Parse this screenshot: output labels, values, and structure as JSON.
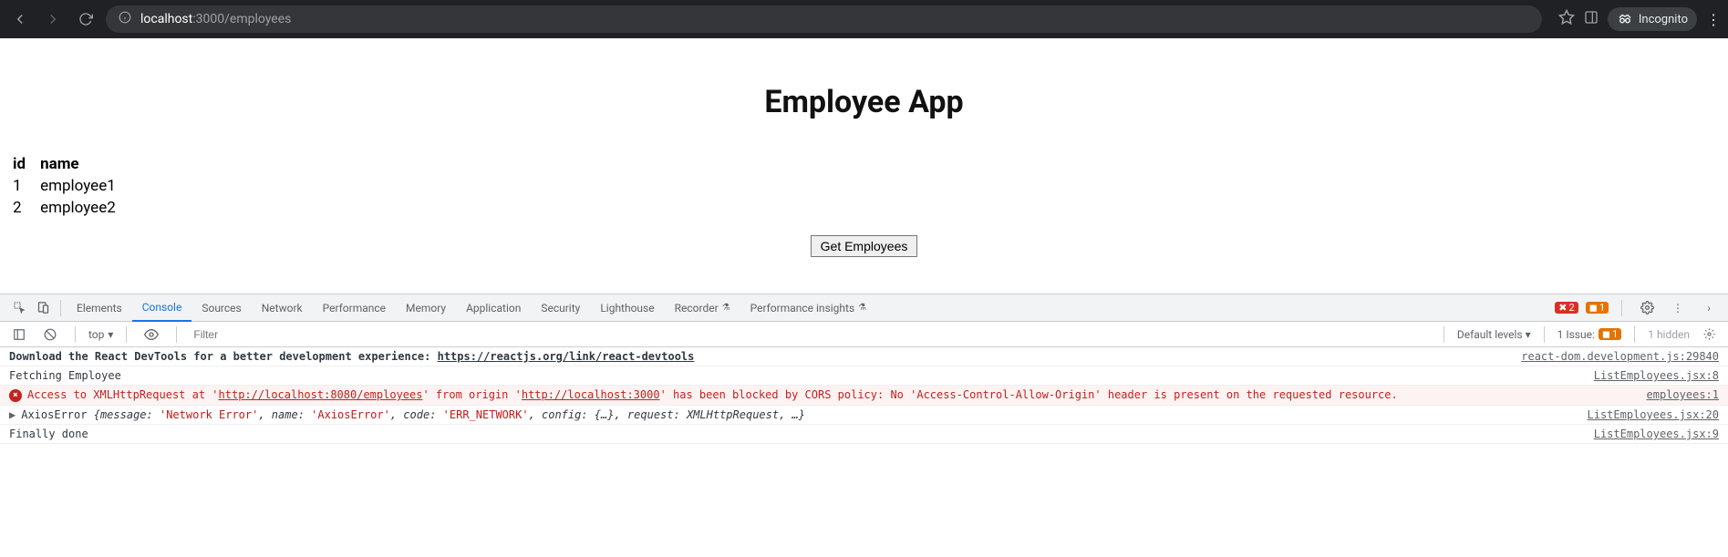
{
  "browser": {
    "url_host": "localhost",
    "url_port_path": ":3000/employees",
    "incognito_label": "Incognito"
  },
  "page": {
    "title": "Employee App",
    "table": {
      "headers": [
        "id",
        "name"
      ],
      "rows": [
        {
          "id": "1",
          "name": "employee1"
        },
        {
          "id": "2",
          "name": "employee2"
        }
      ]
    },
    "get_button_label": "Get Employees"
  },
  "devtools": {
    "tabs": {
      "elements": "Elements",
      "console": "Console",
      "sources": "Sources",
      "network": "Network",
      "performance": "Performance",
      "memory": "Memory",
      "application": "Application",
      "security": "Security",
      "lighthouse": "Lighthouse",
      "recorder": "Recorder",
      "perf_insights": "Performance insights"
    },
    "error_count": "2",
    "warn_count": "1",
    "console_bar": {
      "context": "top",
      "filter_placeholder": "Filter",
      "levels": "Default levels ▾",
      "issue_label": "1 Issue:",
      "issue_count": "1",
      "hidden_label": "1 hidden"
    },
    "logs": {
      "row0_msg_prefix": "Download the React DevTools for a better development experience: ",
      "row0_link": "https://reactjs.org/link/react-devtools",
      "row0_src": "react-dom.development.js:29840",
      "row1_msg": "Fetching Employee",
      "row1_src": "ListEmployees.jsx:8",
      "row2_prefix": "Access to XMLHttpRequest at '",
      "row2_url1": "http://localhost:8080/employees",
      "row2_mid": "' from origin '",
      "row2_url2": "http://localhost:3000",
      "row2_suffix": "' has been blocked by CORS policy: No 'Access-Control-Allow-Origin' header is present on the requested resource.",
      "row2_src": "employees:1",
      "row3_prefix": "AxiosError ",
      "row3_body_open": "{message: ",
      "row3_v1": "'Network Error'",
      "row3_k2": ", name: ",
      "row3_v2": "'AxiosError'",
      "row3_k3": ", code: ",
      "row3_v3": "'ERR_NETWORK'",
      "row3_rest": ", config: {…}, request: XMLHttpRequest, …}",
      "row3_src": "ListEmployees.jsx:20",
      "row4_msg": "Finally done",
      "row4_src": "ListEmployees.jsx:9"
    }
  }
}
